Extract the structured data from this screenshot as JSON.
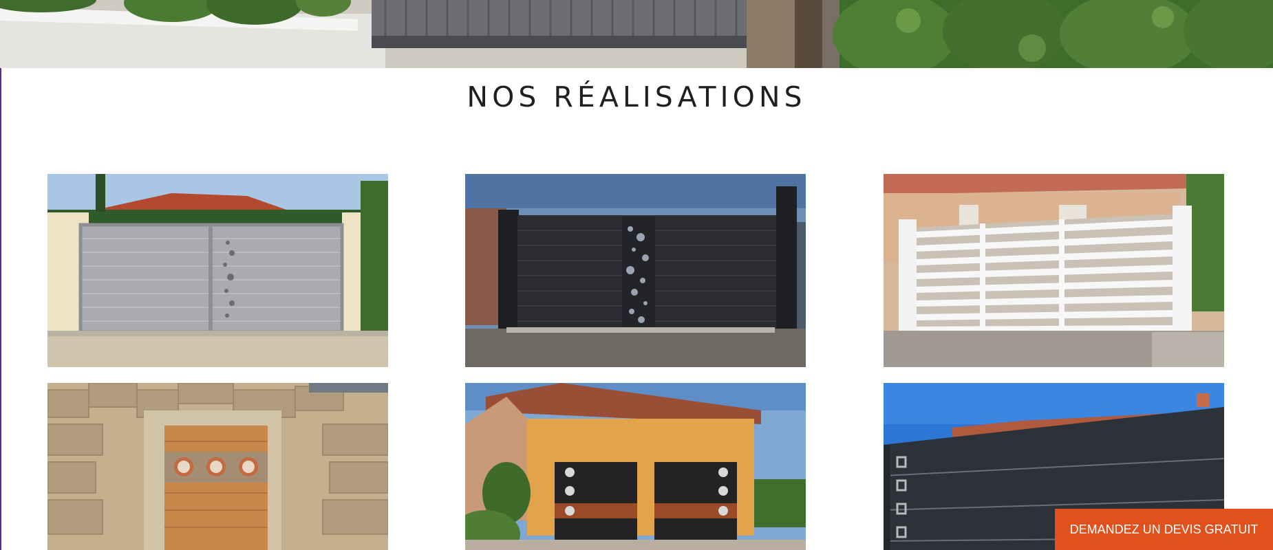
{
  "section": {
    "title": "NOS RÉALISATIONS"
  },
  "gallery": {
    "items": [
      {
        "subject": "grey sliding gate with perforated center panel"
      },
      {
        "subject": "black gate with perforated decorative panel"
      },
      {
        "subject": "white horizontal slatted gate"
      },
      {
        "subject": "wood garage door with portholes in stone wall"
      },
      {
        "subject": "double black and wood garage doors with portholes"
      },
      {
        "subject": "anthracite sliding gate"
      }
    ]
  },
  "cta": {
    "label": "DEMANDEZ UN DEVIS GRATUIT"
  },
  "colors": {
    "accent": "#e2501c",
    "title": "#1f1f1f"
  }
}
